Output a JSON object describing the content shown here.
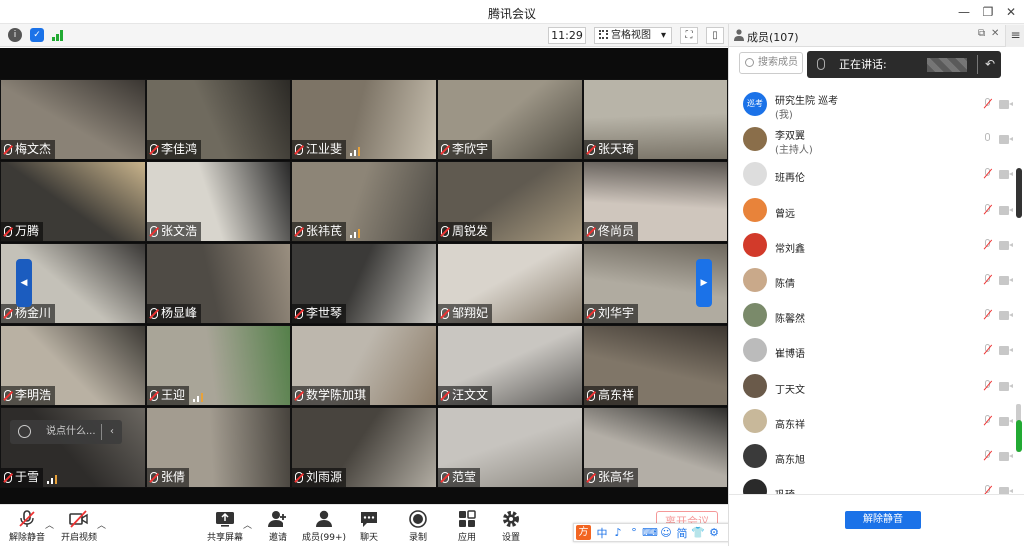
{
  "window": {
    "title": "腾讯会议",
    "minimize": "—",
    "restore": "❐",
    "close": "✕"
  },
  "statusbar": {
    "time": "11:29",
    "view_label": "宫格视图",
    "view_caret": "▾"
  },
  "tiles": [
    {
      "name": "梅文杰",
      "bg": "#8a8276",
      "bg2": "#3a3632"
    },
    {
      "name": "李佳鸿",
      "bg": "#6f6a5e",
      "bg2": "#2c2a26"
    },
    {
      "name": "江业斐",
      "bg": "#7d7466",
      "bg2": "#c8c0b0"
    },
    {
      "name": "李欣宇",
      "bg": "#9c9586",
      "bg2": "#4e4a40"
    },
    {
      "name": "张天琦",
      "bg": "#b8b4a8",
      "bg2": "#7a7468"
    },
    {
      "name": "万腾",
      "bg": "#3c3a36",
      "bg2": "#c9b48c"
    },
    {
      "name": "张文浩",
      "bg": "#d8d5cd",
      "bg2": "#2a2a2a"
    },
    {
      "name": "张祎芪",
      "bg": "#8d8577",
      "bg2": "#4d4a44"
    },
    {
      "name": "周锐发",
      "bg": "#605a50",
      "bg2": "#a99b80"
    },
    {
      "name": "佟尚员",
      "bg": "#cfc6bd",
      "bg2": "#5a5550"
    },
    {
      "name": "杨金川",
      "bg": "#c4c1b8",
      "bg2": "#3a3836"
    },
    {
      "name": "杨显峰",
      "bg": "#4f4b45",
      "bg2": "#9a8f80"
    },
    {
      "name": "李世琴",
      "bg": "#3b3a38",
      "bg2": "#c8c6c0"
    },
    {
      "name": "邹翔妃",
      "bg": "#d9d4cc",
      "bg2": "#857a6a"
    },
    {
      "name": "刘华宇",
      "bg": "#b0aba0",
      "bg2": "#6d675d"
    },
    {
      "name": "李明浩",
      "bg": "#b9b1a3",
      "bg2": "#3d3a35"
    },
    {
      "name": "王迎",
      "bg": "#a9a598",
      "bg2": "#55804a"
    },
    {
      "name": "数学陈加琪",
      "bg": "#bdb7ad",
      "bg2": "#8a7a66"
    },
    {
      "name": "汪文文",
      "bg": "#c9c6c1",
      "bg2": "#5d5b58"
    },
    {
      "name": "高东祥",
      "bg": "#807668",
      "bg2": "#3c3630"
    },
    {
      "name": "于雪",
      "bg": "#2e2c2a",
      "bg2": "#6a6660"
    },
    {
      "name": "张倩",
      "bg": "#a39c90",
      "bg2": "#47433d"
    },
    {
      "name": "刘雨源",
      "bg": "#48443e",
      "bg2": "#b2ada3"
    },
    {
      "name": "范莹",
      "bg": "#c7c4bf",
      "bg2": "#8c8880"
    },
    {
      "name": "张高华",
      "bg": "#b3aea6",
      "bg2": "#2f2e2c"
    }
  ],
  "chat_placeholder": "说点什么...",
  "toolbar": {
    "mute": "解除静音",
    "video": "开启视频",
    "share": "共享屏幕",
    "invite": "邀请",
    "members": "成员(99+)",
    "chat": "聊天",
    "record": "录制",
    "apps": "应用",
    "settings": "设置",
    "leave": "离开会议"
  },
  "ime": {
    "logo": "方",
    "items": [
      "中",
      "♪",
      "°",
      "⌨",
      "☺",
      "简",
      "👕",
      "⚙"
    ]
  },
  "panel": {
    "title": "成员(107)",
    "search_placeholder": "搜索成员",
    "speaking_label": "正在讲话:",
    "menu": "≡",
    "unmute_all": "解除静音",
    "colors": {
      "accent": "#1b72e8"
    }
  },
  "members": [
    {
      "name": "研究生院 巡考",
      "sub": "(我)",
      "avatar_text": "巡考",
      "avatar_color": "#1b72e8",
      "mic_on": false
    },
    {
      "name": "李双翼",
      "sub": "(主持人)",
      "avatar_text": "",
      "avatar_color": "#8a6e4a",
      "mic_on": true
    },
    {
      "name": "班再伦",
      "sub": "",
      "avatar_text": "",
      "avatar_color": "#dddddd",
      "mic_on": false
    },
    {
      "name": "曾远",
      "sub": "",
      "avatar_text": "",
      "avatar_color": "#e8833a",
      "mic_on": false
    },
    {
      "name": "常刘鑫",
      "sub": "",
      "avatar_text": "",
      "avatar_color": "#d23a2a",
      "mic_on": false
    },
    {
      "name": "陈倩",
      "sub": "",
      "avatar_text": "",
      "avatar_color": "#c9a98a",
      "mic_on": false
    },
    {
      "name": "陈馨然",
      "sub": "",
      "avatar_text": "",
      "avatar_color": "#7a8a6a",
      "mic_on": false
    },
    {
      "name": "崔博语",
      "sub": "",
      "avatar_text": "",
      "avatar_color": "#bbbbbb",
      "mic_on": false
    },
    {
      "name": "丁天文",
      "sub": "",
      "avatar_text": "",
      "avatar_color": "#6a5a4a",
      "mic_on": false
    },
    {
      "name": "高东祥",
      "sub": "",
      "avatar_text": "",
      "avatar_color": "#c8b89a",
      "mic_on": false
    },
    {
      "name": "高东旭",
      "sub": "",
      "avatar_text": "",
      "avatar_color": "#3a3a3a",
      "mic_on": false
    },
    {
      "name": "巩琦",
      "sub": "",
      "avatar_text": "",
      "avatar_color": "#2a2a2a",
      "mic_on": false
    }
  ]
}
